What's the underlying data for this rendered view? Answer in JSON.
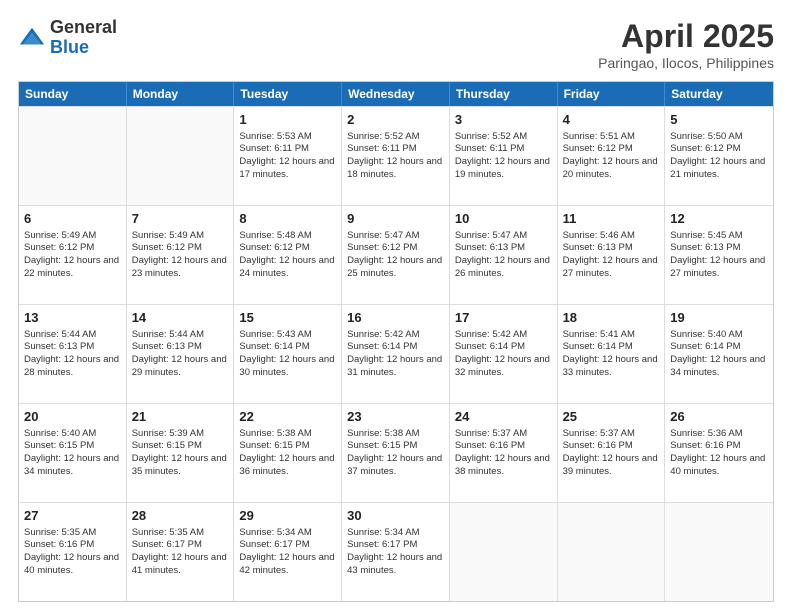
{
  "logo": {
    "general": "General",
    "blue": "Blue"
  },
  "title": {
    "month": "April 2025",
    "location": "Paringao, Ilocos, Philippines"
  },
  "weekdays": [
    "Sunday",
    "Monday",
    "Tuesday",
    "Wednesday",
    "Thursday",
    "Friday",
    "Saturday"
  ],
  "weeks": [
    [
      {
        "day": null,
        "sunrise": null,
        "sunset": null,
        "daylight": null
      },
      {
        "day": null,
        "sunrise": null,
        "sunset": null,
        "daylight": null
      },
      {
        "day": "1",
        "sunrise": "Sunrise: 5:53 AM",
        "sunset": "Sunset: 6:11 PM",
        "daylight": "Daylight: 12 hours and 17 minutes."
      },
      {
        "day": "2",
        "sunrise": "Sunrise: 5:52 AM",
        "sunset": "Sunset: 6:11 PM",
        "daylight": "Daylight: 12 hours and 18 minutes."
      },
      {
        "day": "3",
        "sunrise": "Sunrise: 5:52 AM",
        "sunset": "Sunset: 6:11 PM",
        "daylight": "Daylight: 12 hours and 19 minutes."
      },
      {
        "day": "4",
        "sunrise": "Sunrise: 5:51 AM",
        "sunset": "Sunset: 6:12 PM",
        "daylight": "Daylight: 12 hours and 20 minutes."
      },
      {
        "day": "5",
        "sunrise": "Sunrise: 5:50 AM",
        "sunset": "Sunset: 6:12 PM",
        "daylight": "Daylight: 12 hours and 21 minutes."
      }
    ],
    [
      {
        "day": "6",
        "sunrise": "Sunrise: 5:49 AM",
        "sunset": "Sunset: 6:12 PM",
        "daylight": "Daylight: 12 hours and 22 minutes."
      },
      {
        "day": "7",
        "sunrise": "Sunrise: 5:49 AM",
        "sunset": "Sunset: 6:12 PM",
        "daylight": "Daylight: 12 hours and 23 minutes."
      },
      {
        "day": "8",
        "sunrise": "Sunrise: 5:48 AM",
        "sunset": "Sunset: 6:12 PM",
        "daylight": "Daylight: 12 hours and 24 minutes."
      },
      {
        "day": "9",
        "sunrise": "Sunrise: 5:47 AM",
        "sunset": "Sunset: 6:12 PM",
        "daylight": "Daylight: 12 hours and 25 minutes."
      },
      {
        "day": "10",
        "sunrise": "Sunrise: 5:47 AM",
        "sunset": "Sunset: 6:13 PM",
        "daylight": "Daylight: 12 hours and 26 minutes."
      },
      {
        "day": "11",
        "sunrise": "Sunrise: 5:46 AM",
        "sunset": "Sunset: 6:13 PM",
        "daylight": "Daylight: 12 hours and 27 minutes."
      },
      {
        "day": "12",
        "sunrise": "Sunrise: 5:45 AM",
        "sunset": "Sunset: 6:13 PM",
        "daylight": "Daylight: 12 hours and 27 minutes."
      }
    ],
    [
      {
        "day": "13",
        "sunrise": "Sunrise: 5:44 AM",
        "sunset": "Sunset: 6:13 PM",
        "daylight": "Daylight: 12 hours and 28 minutes."
      },
      {
        "day": "14",
        "sunrise": "Sunrise: 5:44 AM",
        "sunset": "Sunset: 6:13 PM",
        "daylight": "Daylight: 12 hours and 29 minutes."
      },
      {
        "day": "15",
        "sunrise": "Sunrise: 5:43 AM",
        "sunset": "Sunset: 6:14 PM",
        "daylight": "Daylight: 12 hours and 30 minutes."
      },
      {
        "day": "16",
        "sunrise": "Sunrise: 5:42 AM",
        "sunset": "Sunset: 6:14 PM",
        "daylight": "Daylight: 12 hours and 31 minutes."
      },
      {
        "day": "17",
        "sunrise": "Sunrise: 5:42 AM",
        "sunset": "Sunset: 6:14 PM",
        "daylight": "Daylight: 12 hours and 32 minutes."
      },
      {
        "day": "18",
        "sunrise": "Sunrise: 5:41 AM",
        "sunset": "Sunset: 6:14 PM",
        "daylight": "Daylight: 12 hours and 33 minutes."
      },
      {
        "day": "19",
        "sunrise": "Sunrise: 5:40 AM",
        "sunset": "Sunset: 6:14 PM",
        "daylight": "Daylight: 12 hours and 34 minutes."
      }
    ],
    [
      {
        "day": "20",
        "sunrise": "Sunrise: 5:40 AM",
        "sunset": "Sunset: 6:15 PM",
        "daylight": "Daylight: 12 hours and 34 minutes."
      },
      {
        "day": "21",
        "sunrise": "Sunrise: 5:39 AM",
        "sunset": "Sunset: 6:15 PM",
        "daylight": "Daylight: 12 hours and 35 minutes."
      },
      {
        "day": "22",
        "sunrise": "Sunrise: 5:38 AM",
        "sunset": "Sunset: 6:15 PM",
        "daylight": "Daylight: 12 hours and 36 minutes."
      },
      {
        "day": "23",
        "sunrise": "Sunrise: 5:38 AM",
        "sunset": "Sunset: 6:15 PM",
        "daylight": "Daylight: 12 hours and 37 minutes."
      },
      {
        "day": "24",
        "sunrise": "Sunrise: 5:37 AM",
        "sunset": "Sunset: 6:16 PM",
        "daylight": "Daylight: 12 hours and 38 minutes."
      },
      {
        "day": "25",
        "sunrise": "Sunrise: 5:37 AM",
        "sunset": "Sunset: 6:16 PM",
        "daylight": "Daylight: 12 hours and 39 minutes."
      },
      {
        "day": "26",
        "sunrise": "Sunrise: 5:36 AM",
        "sunset": "Sunset: 6:16 PM",
        "daylight": "Daylight: 12 hours and 40 minutes."
      }
    ],
    [
      {
        "day": "27",
        "sunrise": "Sunrise: 5:35 AM",
        "sunset": "Sunset: 6:16 PM",
        "daylight": "Daylight: 12 hours and 40 minutes."
      },
      {
        "day": "28",
        "sunrise": "Sunrise: 5:35 AM",
        "sunset": "Sunset: 6:17 PM",
        "daylight": "Daylight: 12 hours and 41 minutes."
      },
      {
        "day": "29",
        "sunrise": "Sunrise: 5:34 AM",
        "sunset": "Sunset: 6:17 PM",
        "daylight": "Daylight: 12 hours and 42 minutes."
      },
      {
        "day": "30",
        "sunrise": "Sunrise: 5:34 AM",
        "sunset": "Sunset: 6:17 PM",
        "daylight": "Daylight: 12 hours and 43 minutes."
      },
      {
        "day": null,
        "sunrise": null,
        "sunset": null,
        "daylight": null
      },
      {
        "day": null,
        "sunrise": null,
        "sunset": null,
        "daylight": null
      },
      {
        "day": null,
        "sunrise": null,
        "sunset": null,
        "daylight": null
      }
    ]
  ]
}
